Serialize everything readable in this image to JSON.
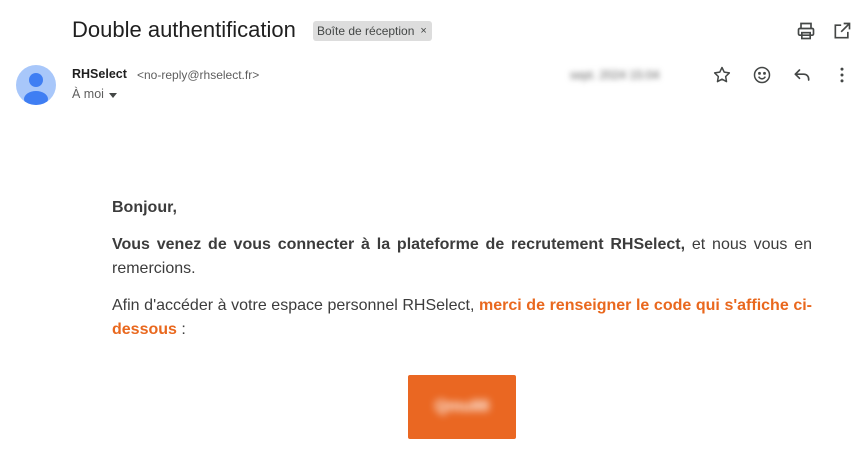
{
  "header": {
    "subject": "Double authentification",
    "label": "Boîte de réception",
    "label_close": "×",
    "print_icon": "print-icon",
    "open_new_window_icon": "open-in-new-window-icon"
  },
  "sender": {
    "avatar_icon": "person-avatar-icon",
    "name": "RHSelect",
    "email": "<no-reply@rhselect.fr>",
    "recipient": "À moi",
    "timestamp": "sept. 2024 15:04",
    "actions": [
      "star-icon",
      "emoji-reaction-icon",
      "reply-icon",
      "more-vertical-icon"
    ]
  },
  "message": {
    "greeting": "Bonjour,",
    "line1_bold": "Vous venez de vous connecter à la plateforme de recrutement RHSelect,",
    "line1_rest": " et nous vous en remercions.",
    "line2_start": "Afin d'accéder à votre espace personnel RHSelect, ",
    "line2_orange": "merci de renseigner le code qui s'affiche ci-dessous",
    "line2_end": " :",
    "code": "Qmu88"
  },
  "colors": {
    "accent_orange": "#ea6722",
    "avatar_bg": "#a8c7fa",
    "avatar_fg": "#3f7ef3",
    "chip_bg": "#dddddd"
  }
}
